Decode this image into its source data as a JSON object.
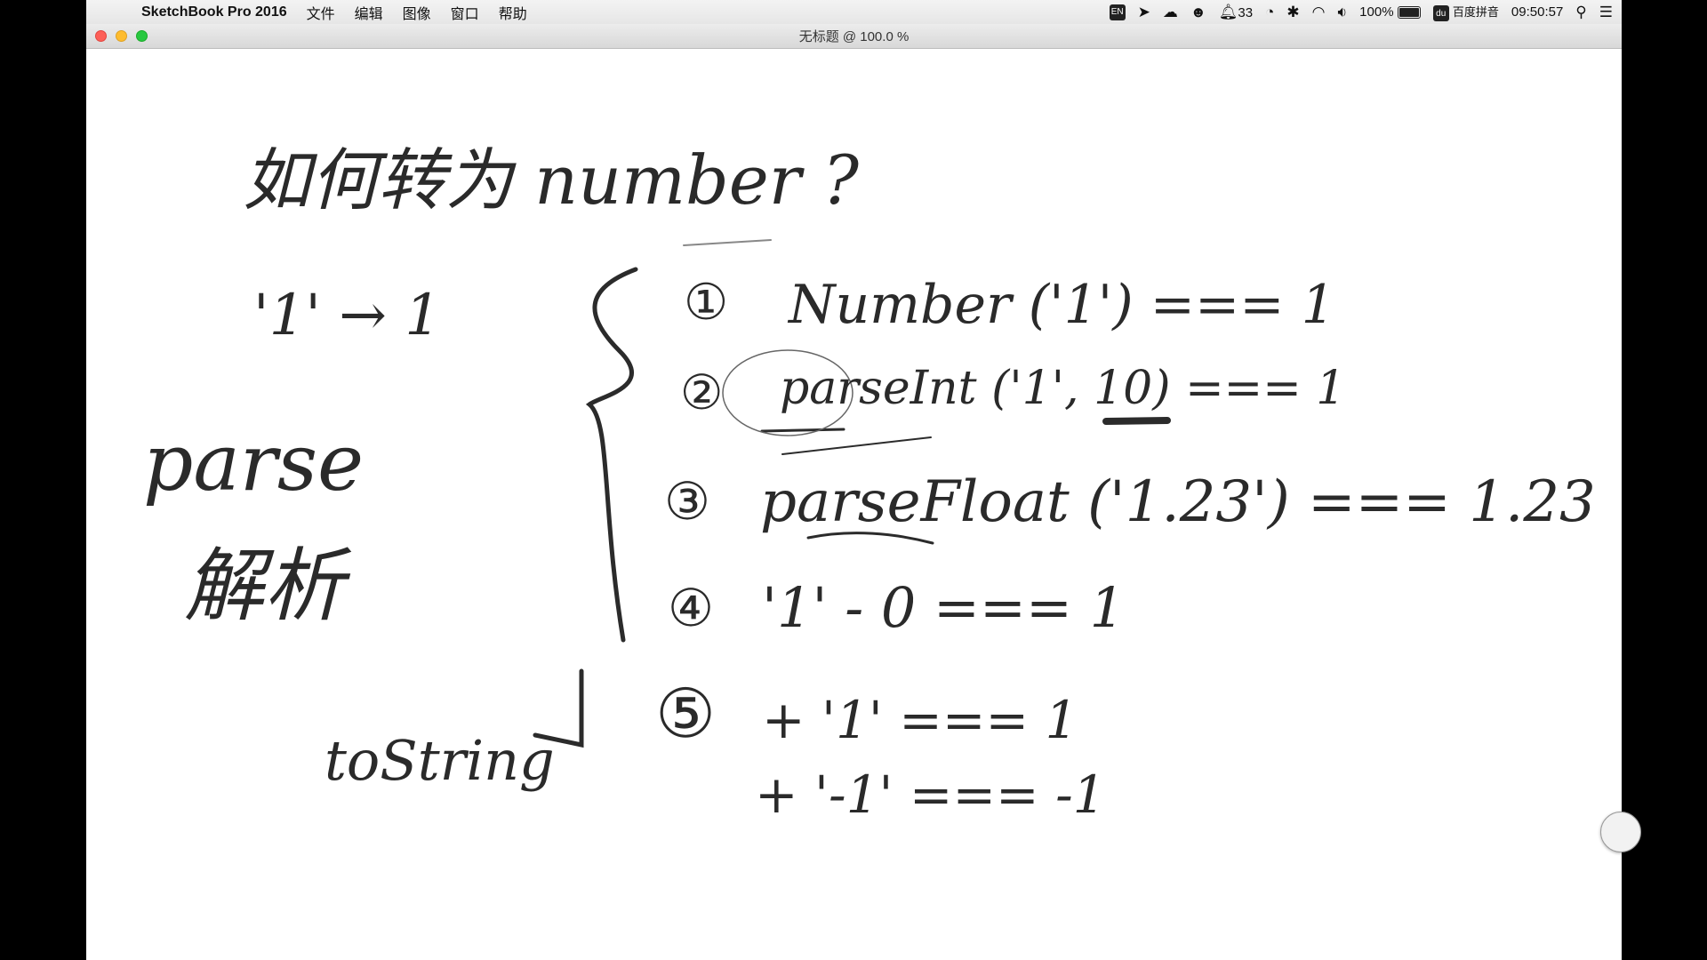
{
  "menubar": {
    "app_name": "SketchBook Pro 2016",
    "menus": [
      "文件",
      "编辑",
      "图像",
      "窗口",
      "帮助"
    ],
    "status": {
      "input_lang": "EN",
      "notification_count": "33",
      "battery": "100%",
      "ime": "百度拼音",
      "ime_badge": "du",
      "time": "09:50:57"
    }
  },
  "window": {
    "title": "无标题 @ 100.0 %"
  },
  "sketch": {
    "heading": "如何转为 number ?",
    "conversion": "'1' → 1",
    "parse_word": "parse",
    "parse_cn": "解析",
    "tostring": "toString",
    "items": [
      {
        "num": "①",
        "text": "Number ('1') === 1"
      },
      {
        "num": "②",
        "text": "parseInt ('1', 10) === 1"
      },
      {
        "num": "③",
        "text": "parseFloat ('1.23') === 1.23"
      },
      {
        "num": "④",
        "text": "'1' - 0 === 1"
      },
      {
        "num": "⑤",
        "text": "+ '1' === 1"
      },
      {
        "num": "",
        "text": "+ '-1' === -1"
      }
    ]
  }
}
